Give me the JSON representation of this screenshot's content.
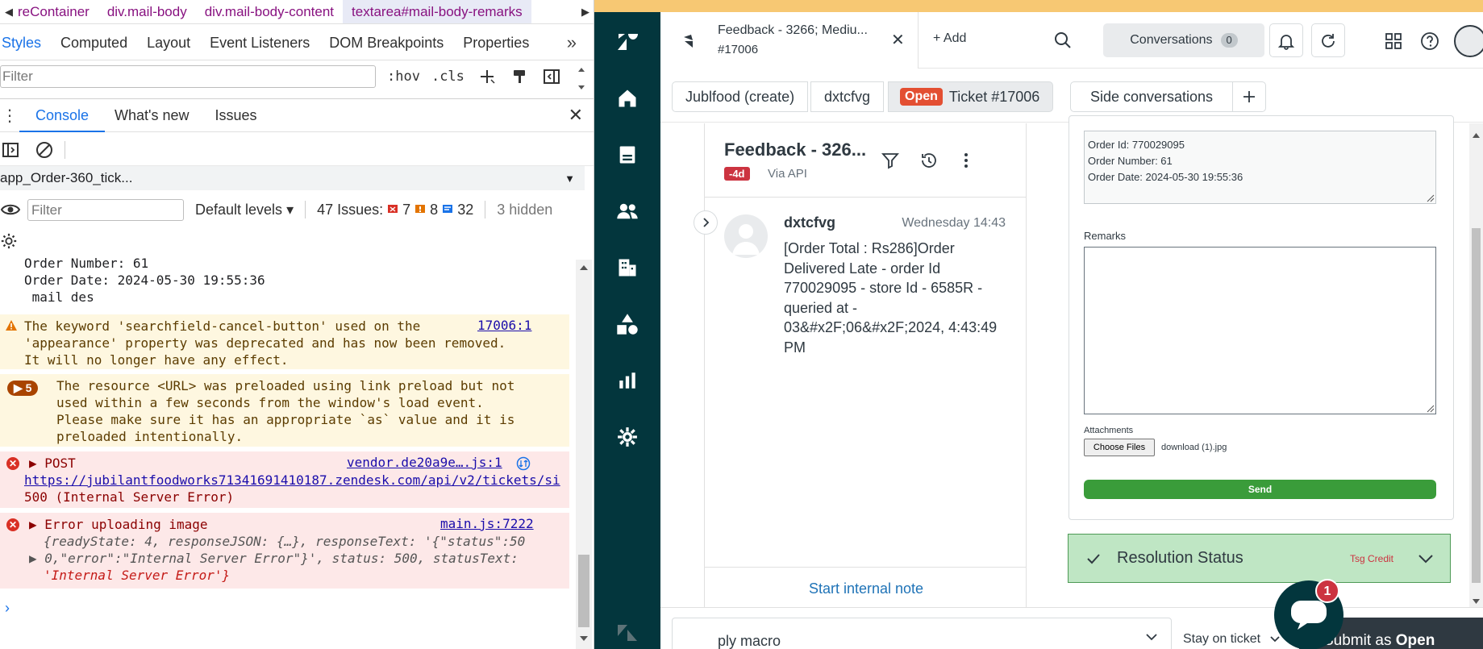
{
  "devtools": {
    "breadcrumbs": [
      "reContainer",
      "div.mail-body",
      "div.mail-body-content",
      "textarea#mail-body-remarks"
    ],
    "panel_tabs": [
      "Styles",
      "Computed",
      "Layout",
      "Event Listeners",
      "DOM Breakpoints",
      "Properties"
    ],
    "styles_filter_placeholder": "Filter",
    "hov_label": ":hov",
    "cls_label": ".cls",
    "drawer_tabs": [
      "Console",
      "What's new",
      "Issues"
    ],
    "context": "app_Order-360_tick...",
    "console_filter_placeholder": "Filter",
    "default_levels": "Default levels",
    "issues_label": "47 Issues:",
    "issues_errors": "7",
    "issues_warnings": "8",
    "issues_info": "32",
    "hidden_label": "3 hidden",
    "log_lines": [
      "Order Number: 61",
      "Order Date: 2024-05-30 19:55:36",
      " mail des"
    ],
    "warning_msg": {
      "lines": [
        "The keyword 'searchfield-cancel-button' used on the",
        "'appearance' property was deprecated and has now been removed.",
        "It will no longer have any effect."
      ],
      "source": "17006:1"
    },
    "preload_msg": {
      "count": "5",
      "lines": [
        "The resource <URL> was preloaded using link preload but not",
        "used within a few seconds from the window's load event.",
        "Please make sure it has an appropriate `as` value and it is",
        "preloaded intentionally."
      ]
    },
    "post_error": {
      "label": "POST",
      "source": "vendor.de20a9e….js:1",
      "url": "https://jubilantfoodworks71341691410187.zendesk.com/api/v2/tickets/si",
      "status": "500 (Internal Server Error)"
    },
    "upload_error": {
      "title": "Error uploading image",
      "source": "main.js:7222",
      "obj_line1": "{readyState: 4, responseJSON: {…}, responseText: '{\"status\":50",
      "obj_line2": "0,\"error\":\"Internal Server Error\"}', status: 500, statusText:",
      "obj_line3": "'Internal Server Error'}"
    }
  },
  "zendesk": {
    "tab": {
      "title": "Feedback - 3266; Mediu...",
      "subtitle": "#17006"
    },
    "add_label": "Add",
    "conversations_label": "Conversations",
    "conversations_count": "0",
    "breadcrumbs": {
      "org": "Jublfood (create)",
      "user": "dxtcfvg",
      "status": "Open",
      "ticket": "Ticket #17006"
    },
    "side_conversations": "Side conversations",
    "conversation": {
      "title": "Feedback - 326...",
      "age": "-4d",
      "via": "Via API",
      "author": "dxtcfvg",
      "time": "Wednesday 14:43",
      "body": "[Order Total : Rs286]Order Delivered Late - order Id 770029095 - store Id - 6585R - queried at - 03&#x2F;06&#x2F;2024, 4:43:49 PM"
    },
    "internal_note": "Start internal note",
    "app": {
      "order_lines": [
        "Order Id: 770029095",
        "Order Number: 61",
        "Order Date: 2024-05-30 19:55:36"
      ],
      "remarks_label": "Remarks",
      "attachments_label": "Attachments",
      "choose_files": "Choose Files",
      "file_name": "download (1).jpg",
      "send_label": "Send",
      "resolution_title": "Resolution Status",
      "resolution_value": "Tsg Credit"
    },
    "macro_label": "ply macro",
    "stay_label": "Stay on ticket",
    "submit_prefix": "Submit as",
    "submit_status": "Open",
    "chat_badge": "1"
  }
}
